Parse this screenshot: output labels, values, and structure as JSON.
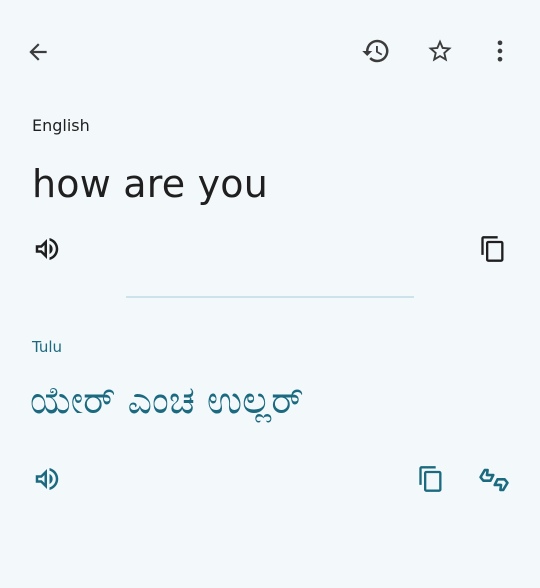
{
  "source": {
    "language": "English",
    "text": "how are you"
  },
  "target": {
    "language": "Tulu",
    "text": "ಯೇರ್ ಎಂಚ ಉಲ್ಲರ್"
  },
  "icons": {
    "back": "arrow-back-icon",
    "history": "history-icon",
    "favorite": "star-outline-icon",
    "more": "more-vert-icon",
    "speak": "volume-icon",
    "copy": "copy-icon",
    "feedback": "thumbs-feedback-icon"
  },
  "colors": {
    "background": "#f3f8fb",
    "source_text": "#1f1f1f",
    "accent": "#1b6a80"
  }
}
